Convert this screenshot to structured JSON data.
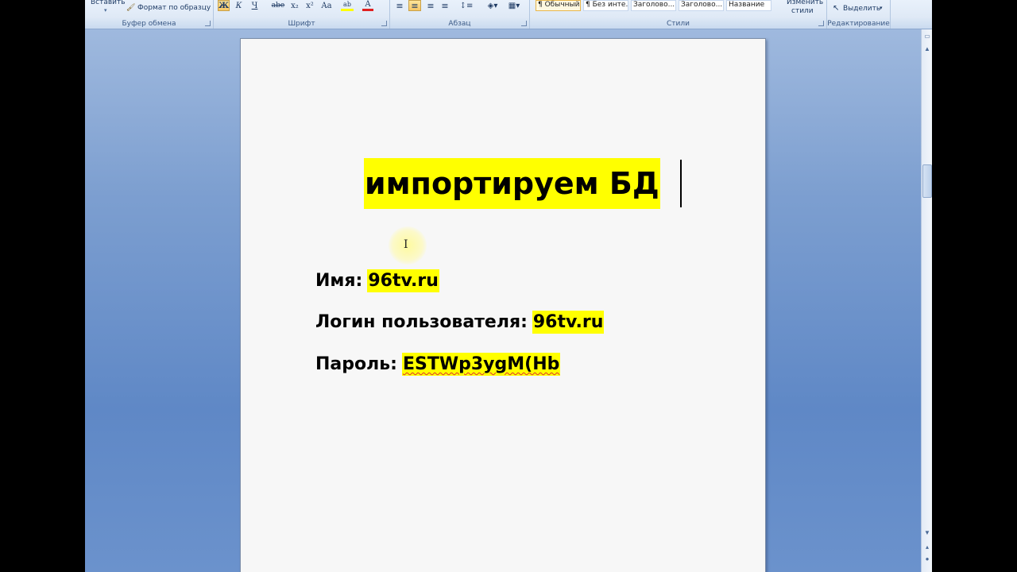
{
  "ribbon": {
    "clipboard": {
      "paste_label": "Вставить",
      "format_painter_label": "Формат по образцу",
      "group_label": "Буфер обмена"
    },
    "font": {
      "group_label": "Шрифт",
      "bold": "Ж",
      "italic": "К",
      "underline": "Ч",
      "strike": "abe",
      "subscript": "x₂",
      "superscript": "x²",
      "change_case": "Aa",
      "highlight": "ab",
      "font_color": "A"
    },
    "paragraph": {
      "group_label": "Абзац"
    },
    "styles": {
      "group_label": "Стили",
      "items": [
        "¶ Обычный",
        "¶ Без инте...",
        "Заголово...",
        "Заголово...",
        "Название"
      ],
      "change_styles_line1": "Изменить",
      "change_styles_line2": "стили"
    },
    "editing": {
      "select_label": "Выделить",
      "group_label": "Редактирование"
    }
  },
  "document": {
    "title": "импортируем БД",
    "lines": [
      {
        "label": "Имя:",
        "value": "96tv.ru"
      },
      {
        "label": "Логин пользователя:",
        "value": "96tv.ru"
      },
      {
        "label": "Пароль:",
        "value": "ESTWp3ygM(Hb"
      }
    ]
  },
  "colors": {
    "highlight": "#ffff00",
    "workspace": "#6b92cc"
  }
}
